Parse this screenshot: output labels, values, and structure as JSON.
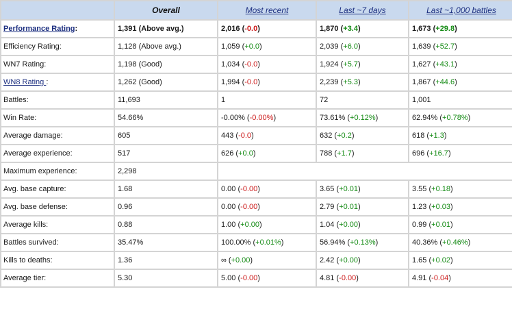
{
  "headers": {
    "overall": "Overall",
    "most_recent": "Most recent",
    "last7": "Last ~7 days",
    "last1000": "Last ~1,000 battles"
  },
  "rows": [
    {
      "label": "Performance Rating",
      "label_suffix": ":",
      "link": true,
      "bold": true,
      "overall": "1,391 (Above avg.)",
      "recent": {
        "v": "2,016",
        "d": "-0.0",
        "s": "neg"
      },
      "week": {
        "v": "1,870",
        "d": "+3.4",
        "s": "pos"
      },
      "k": {
        "v": "1,673",
        "d": "+29.8",
        "s": "pos"
      }
    },
    {
      "label": "Efficiency Rating:",
      "overall": "1,128 (Above avg.)",
      "recent": {
        "v": "1,059",
        "d": "+0.0",
        "s": "pos"
      },
      "week": {
        "v": "2,039",
        "d": "+6.0",
        "s": "pos"
      },
      "k": {
        "v": "1,639",
        "d": "+52.7",
        "s": "pos"
      }
    },
    {
      "label": "WN7 Rating:",
      "overall": "1,198 (Good)",
      "recent": {
        "v": "1,034",
        "d": "-0.0",
        "s": "neg"
      },
      "week": {
        "v": "1,924",
        "d": "+5.7",
        "s": "pos"
      },
      "k": {
        "v": "1,627",
        "d": "+43.1",
        "s": "pos"
      }
    },
    {
      "label": "WN8 Rating ",
      "label_suffix": ":",
      "link": true,
      "overall": "1,262 (Good)",
      "recent": {
        "v": "1,994",
        "d": "-0.0",
        "s": "neg"
      },
      "week": {
        "v": "2,239",
        "d": "+5.3",
        "s": "pos"
      },
      "k": {
        "v": "1,867",
        "d": "+44.6",
        "s": "pos"
      }
    },
    {
      "label": "Battles:",
      "overall": "11,693",
      "recent": {
        "v": "1"
      },
      "week": {
        "v": "72"
      },
      "k": {
        "v": "1,001"
      }
    },
    {
      "label": "Win Rate:",
      "overall": "54.66%",
      "recent": {
        "v": "-0.00%",
        "d": "-0.00%",
        "s": "neg"
      },
      "week": {
        "v": "73.61%",
        "d": "+0.12%",
        "s": "pos"
      },
      "k": {
        "v": "62.94%",
        "d": "+0.78%",
        "s": "pos"
      }
    },
    {
      "label": "Average damage:",
      "overall": "605",
      "recent": {
        "v": "443",
        "d": "-0.0",
        "s": "neg"
      },
      "week": {
        "v": "632",
        "d": "+0.2",
        "s": "pos"
      },
      "k": {
        "v": "618",
        "d": "+1.3",
        "s": "pos"
      }
    },
    {
      "label": "Average experience:",
      "overall": "517",
      "recent": {
        "v": "626",
        "d": "+0.0",
        "s": "pos"
      },
      "week": {
        "v": "788",
        "d": "+1.7",
        "s": "pos"
      },
      "k": {
        "v": "696",
        "d": "+16.7",
        "s": "pos"
      }
    },
    {
      "label": "Maximum experience:",
      "overall": "2,298",
      "only_overall": true
    },
    {
      "label": "Avg. base capture:",
      "overall": "1.68",
      "recent": {
        "v": "0.00",
        "d": "-0.00",
        "s": "neg"
      },
      "week": {
        "v": "3.65",
        "d": "+0.01",
        "s": "pos"
      },
      "k": {
        "v": "3.55",
        "d": "+0.18",
        "s": "pos"
      }
    },
    {
      "label": "Avg. base defense:",
      "overall": "0.96",
      "recent": {
        "v": "0.00",
        "d": "-0.00",
        "s": "neg"
      },
      "week": {
        "v": "2.79",
        "d": "+0.01",
        "s": "pos"
      },
      "k": {
        "v": "1.23",
        "d": "+0.03",
        "s": "pos"
      }
    },
    {
      "label": "Average kills:",
      "overall": "0.88",
      "recent": {
        "v": "1.00",
        "d": "+0.00",
        "s": "pos"
      },
      "week": {
        "v": "1.04",
        "d": "+0.00",
        "s": "pos"
      },
      "k": {
        "v": "0.99",
        "d": "+0.01",
        "s": "pos"
      }
    },
    {
      "label": "Battles survived:",
      "overall": "35.47%",
      "recent": {
        "v": "100.00%",
        "d": "+0.01%",
        "s": "pos"
      },
      "week": {
        "v": "56.94%",
        "d": "+0.13%",
        "s": "pos"
      },
      "k": {
        "v": "40.36%",
        "d": "+0.46%",
        "s": "pos"
      }
    },
    {
      "label": "Kills to deaths:",
      "overall": "1.36",
      "recent": {
        "v": "∞",
        "d": "+0.00",
        "s": "pos"
      },
      "week": {
        "v": "2.42",
        "d": "+0.00",
        "s": "pos"
      },
      "k": {
        "v": "1.65",
        "d": "+0.02",
        "s": "pos"
      }
    },
    {
      "label": "Average tier:",
      "overall": "5.30",
      "recent": {
        "v": "5.00",
        "d": "-0.00",
        "s": "neg"
      },
      "week": {
        "v": "4.81",
        "d": "-0.00",
        "s": "neg"
      },
      "k": {
        "v": "4.91",
        "d": "-0.04",
        "s": "neg"
      }
    }
  ],
  "colors": {
    "header_bg": "#c9d9ee",
    "positive": "#138a13",
    "negative": "#cc1a1a",
    "link": "#1c2f80"
  }
}
